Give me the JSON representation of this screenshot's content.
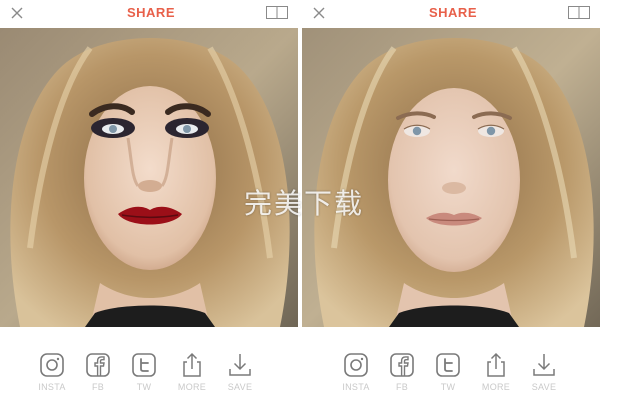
{
  "left_panel": {
    "title": "SHARE",
    "close_icon": "close-icon",
    "compare_icon": "compare-toggle-icon",
    "photo": "after-makeup-photo",
    "actions": [
      {
        "label": "INSTA",
        "icon": "instagram-icon"
      },
      {
        "label": "FB",
        "icon": "facebook-icon"
      },
      {
        "label": "TW",
        "icon": "twitter-icon"
      },
      {
        "label": "MORE",
        "icon": "share-more-icon"
      },
      {
        "label": "SAVE",
        "icon": "download-icon"
      }
    ]
  },
  "right_panel": {
    "title": "SHARE",
    "close_icon": "close-icon",
    "compare_icon": "compare-toggle-icon",
    "photo": "before-makeup-photo",
    "actions": [
      {
        "label": "INSTA",
        "icon": "instagram-icon"
      },
      {
        "label": "FB",
        "icon": "facebook-icon"
      },
      {
        "label": "TW",
        "icon": "twitter-icon"
      },
      {
        "label": "MORE",
        "icon": "share-more-icon"
      },
      {
        "label": "SAVE",
        "icon": "download-icon"
      }
    ]
  },
  "watermark": "完美下载",
  "colors": {
    "accent": "#e8604a",
    "icon": "#7a7a7a",
    "label": "#c9c9c9"
  }
}
